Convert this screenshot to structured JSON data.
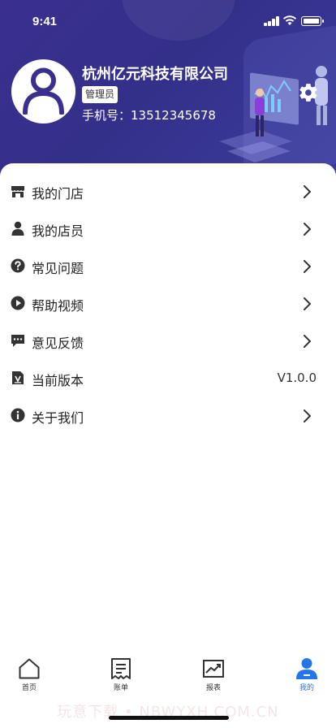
{
  "status_bar": {
    "time": "9:41"
  },
  "profile": {
    "company": "杭州亿元科技有限公司",
    "role": "管理员",
    "phone": "手机号：13512345678"
  },
  "menu": [
    {
      "label": "我的门店",
      "icon": "store-icon"
    },
    {
      "label": "我的店员",
      "icon": "person-icon"
    },
    {
      "label": "常见问题",
      "icon": "question-icon"
    },
    {
      "label": "帮助视频",
      "icon": "play-icon"
    },
    {
      "label": "意见反馈",
      "icon": "feedback-icon"
    },
    {
      "label": "当前版本",
      "icon": "version-icon",
      "value": "V1.0.0"
    },
    {
      "label": "关于我们",
      "icon": "info-icon"
    }
  ],
  "tabs": [
    {
      "label": "首页",
      "icon": "home-icon"
    },
    {
      "label": "账单",
      "icon": "bill-icon"
    },
    {
      "label": "报表",
      "icon": "report-icon"
    },
    {
      "label": "我的",
      "icon": "user-icon",
      "active": true
    }
  ],
  "watermark": "玩意下载 • NBWYXH.COM.CN",
  "colors": {
    "header": "#3a2f8f",
    "accent": "#2475e8"
  }
}
